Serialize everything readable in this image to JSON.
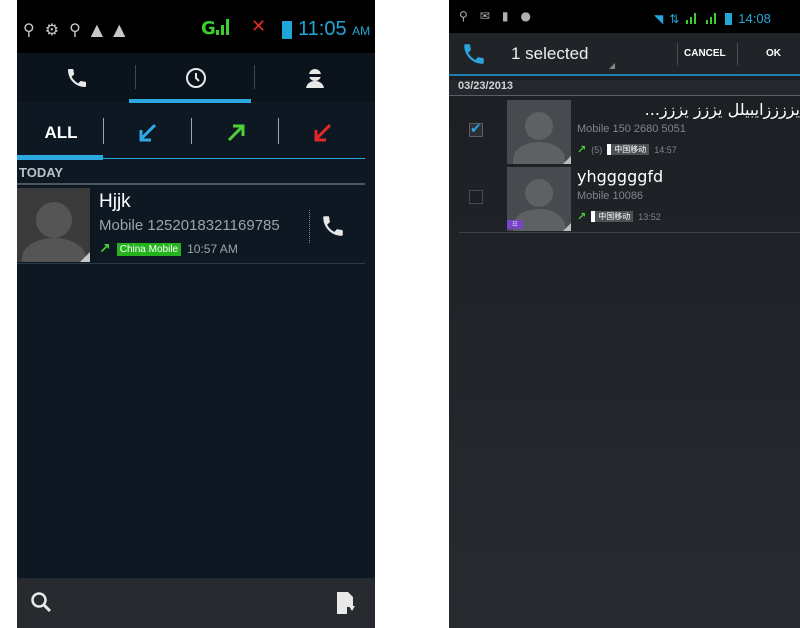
{
  "left_phone": {
    "status": {
      "network": "G",
      "clock_time": "11:05",
      "clock_ampm": "AM"
    },
    "tabs": [
      "phone",
      "recent",
      "contacts"
    ],
    "filters": {
      "all_label": "ALL"
    },
    "section_title": "TODAY",
    "call": {
      "name": "Hjjk",
      "number": "Mobile 1252018321169785",
      "carrier": "China Mobile",
      "time": "10:57 AM"
    }
  },
  "right_phone": {
    "status": {
      "clock_time": "14:08"
    },
    "actionbar": {
      "title": "1 selected",
      "cancel_label": "CANCEL",
      "ok_label": "OK"
    },
    "section_date": "03/23/2013",
    "calls": [
      {
        "name": "يززززايبيلل يززز يززز...",
        "number": "Mobile 150 2680 5051",
        "count": "(5)",
        "carrier": "中国移动",
        "time": "14:57",
        "checked": true
      },
      {
        "name": "yhgggggfd",
        "number": "Mobile 10086",
        "carrier": "中国移动",
        "time": "13:52",
        "checked": false
      }
    ]
  },
  "colors": {
    "accent_blue": "#29a9e0",
    "incoming_blue": "#2fa8e6",
    "outgoing_green": "#4ed036",
    "missed_red": "#e3262b",
    "carrier_green": "#24b31c"
  }
}
